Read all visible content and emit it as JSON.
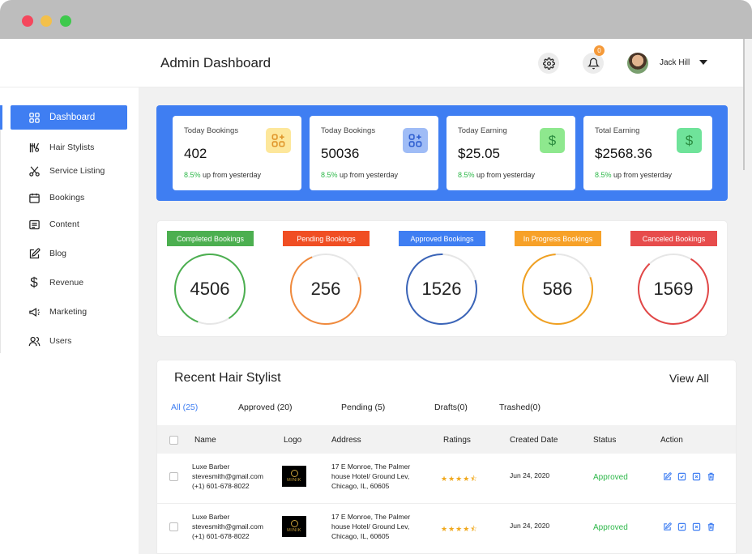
{
  "header": {
    "title": "Admin Dashboard",
    "user_name": "Jack Hill",
    "notification_count": "0"
  },
  "sidebar": {
    "items": [
      {
        "label": "Dashboard",
        "icon": "grid-icon",
        "active": true
      },
      {
        "label": "Hair Stylists",
        "icon": "hair-tools-icon"
      },
      {
        "label": "Service Listing",
        "icon": "scissors-icon"
      },
      {
        "label": "Bookings",
        "icon": "calendar-icon"
      },
      {
        "label": "Content",
        "icon": "document-icon"
      },
      {
        "label": "Blog",
        "icon": "edit-icon"
      },
      {
        "label": "Revenue",
        "icon": "dollar-icon"
      },
      {
        "label": "Marketing",
        "icon": "megaphone-icon"
      },
      {
        "label": "Users",
        "icon": "users-icon"
      }
    ]
  },
  "stats": [
    {
      "label": "Today Bookings",
      "value": "402",
      "pct": "8.5%",
      "suffix": " up from yesterday",
      "icon": "grid-plus-icon",
      "icon_bg": "#fde79b",
      "icon_color": "#e0962b"
    },
    {
      "label": "Today Bookings",
      "value": "50036",
      "pct": "8.5%",
      "suffix": " up from yesterday",
      "icon": "grid-plus-icon",
      "icon_bg": "#9fbcf6",
      "icon_color": "#2f5fd1"
    },
    {
      "label": "Today Earning",
      "value": "$25.05",
      "pct": "8.5%",
      "suffix": " up from yesterday",
      "icon": "dollar-icon",
      "icon_bg": "#8ee88e",
      "icon_color": "#1f7a32"
    },
    {
      "label": "Total Earning",
      "value": "$2568.36",
      "pct": "8.5%",
      "suffix": " up from yesterday",
      "icon": "dollar-icon",
      "icon_bg": "#6fe39a",
      "icon_color": "#1f7a32"
    }
  ],
  "booking_status": [
    {
      "label": "Completed Bookings",
      "value": "4506",
      "color": "#4caf50"
    },
    {
      "label": "Pending Bookings",
      "value": "256",
      "color": "#f04e23"
    },
    {
      "label": "Approved Bookings",
      "value": "1526",
      "color": "#3f7ef2"
    },
    {
      "label": "In Progress Bookings",
      "value": "586",
      "color": "#f7a128"
    },
    {
      "label": "Canceled Bookings",
      "value": "1569",
      "color": "#e74c4c"
    }
  ],
  "recent": {
    "title": "Recent Hair Stylist",
    "view_all": "View All",
    "filters": [
      "All (25)",
      "Approved (20)",
      "Pending (5)",
      "Drafts(0)",
      "Trashed(0)"
    ],
    "columns": [
      "Name",
      "Logo",
      "Address",
      "Ratings",
      "Created Date",
      "Status",
      "Action"
    ],
    "rows": [
      {
        "name": "Luxe Barber",
        "email": "stevesmith@gmail.com",
        "phone": "(+1) 601-678-8022",
        "logo": "MINIK",
        "address1": "17 E Monroe, The Palmer",
        "address2": "house Hotel/ Ground Lev,",
        "address3": "Chicago, IL, 60605",
        "rating": 4.5,
        "stars": "★★★★⯪",
        "date": "Jun 24, 2020",
        "status": "Approved"
      },
      {
        "name": "Luxe Barber",
        "email": "stevesmith@gmail.com",
        "phone": "(+1) 601-678-8022",
        "logo": "MINIK",
        "address1": "17 E Monroe, The Palmer",
        "address2": "house Hotel/ Ground Lev,",
        "address3": "Chicago, IL, 60605",
        "rating": 4.5,
        "stars": "★★★★⯪",
        "date": "Jun 24, 2020",
        "status": "Approved"
      }
    ]
  },
  "colors": {
    "accent": "#3f7ef2",
    "success": "#2eb84a"
  }
}
